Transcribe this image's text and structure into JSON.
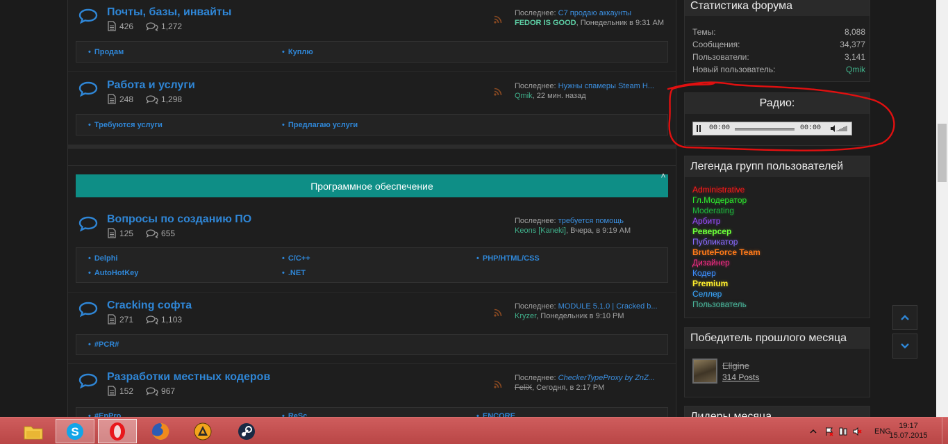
{
  "categories": [
    {
      "nodes": [
        {
          "title": "Почты, базы, инвайты",
          "threads": "426",
          "messages": "1,272",
          "last_prefix": "Последнее:",
          "last_title": "C7 продаю аккаунты",
          "last_user": "FEDOR IS GOOD",
          "last_time": ", Понедельник в 9:31 AM",
          "subforums": [
            "Продам",
            "Куплю"
          ]
        },
        {
          "title": "Работа и услуги",
          "threads": "248",
          "messages": "1,298",
          "last_prefix": "Последнее:",
          "last_title": "Нужны спамеры Steam H...",
          "last_user": "Qmik",
          "last_time": ", 22 мин. назад",
          "subforums": [
            "Требуются услуги",
            "Предлагаю услуги"
          ]
        }
      ]
    },
    {
      "header": "Программное обеспечение",
      "collapse_glyph": "˄",
      "nodes": [
        {
          "title": "Вопросы по созданию ПО",
          "threads": "125",
          "messages": "655",
          "last_prefix": "Последнее:",
          "last_title": "требуется помощь",
          "last_user": "Keons [Kaneki]",
          "last_time": ", Вчера, в 9:19 AM",
          "subforums": [
            "Delphi",
            "C/C++",
            "PHP/HTML/CSS",
            "AutoHotKey",
            ".NET"
          ]
        },
        {
          "title": "Cracking софта",
          "threads": "271",
          "messages": "1,103",
          "last_prefix": "Последнее:",
          "last_title": "MODULE 5.1.0 | Cracked b...",
          "last_user": "Kryzer",
          "last_time": ", Понедельник в 9:10 PM",
          "subforums": [
            "#PCR#"
          ]
        },
        {
          "title": "Разработки местных кодеров",
          "threads": "152",
          "messages": "967",
          "last_prefix": "Последнее:",
          "last_title": "CheckerTypeProxy by ZnZ...",
          "last_user": "FeliX",
          "last_time": ", Сегодня, в 2:17 PM",
          "subforums": [
            "#EnPro",
            "ReSc",
            "ENCORE"
          ]
        }
      ]
    }
  ],
  "sidebar": {
    "stats": {
      "title": "Статистика форума",
      "rows": [
        {
          "label": "Темы:",
          "value": "8,088"
        },
        {
          "label": "Сообщения:",
          "value": "34,377"
        },
        {
          "label": "Пользователи:",
          "value": "3,141"
        },
        {
          "label": "Новый пользователь:",
          "value": "Qmik"
        }
      ]
    },
    "radio": {
      "title": "Радио:",
      "time_elapsed": "00:00",
      "time_total": "00:00"
    },
    "legend": {
      "title": "Легенда групп пользователей",
      "items": [
        {
          "label": "Administrative",
          "color": "#ff1a1a"
        },
        {
          "label": "Гл.Модератор",
          "color": "#2ee82e"
        },
        {
          "label": "Moderating",
          "color": "#1fb53c"
        },
        {
          "label": "Арбитр",
          "color": "#9a4dff"
        },
        {
          "label": "Реверсер",
          "color": "#6cff3a"
        },
        {
          "label": "Публикатор",
          "color": "#8a6bff"
        },
        {
          "label": "BruteForce Team",
          "color": "#ff7a1a"
        },
        {
          "label": "Дизайнер",
          "color": "#ff2d8a"
        },
        {
          "label": "Кодер",
          "color": "#3d8fff"
        },
        {
          "label": "Premium",
          "color": "#ffef2e"
        },
        {
          "label": "Селлер",
          "color": "#3aa8ff"
        },
        {
          "label": "Пользователь",
          "color": "#4ab59a"
        }
      ]
    },
    "winner": {
      "title": "Победитель прошлого месяца",
      "name": "Ellgine",
      "posts": "314 Posts"
    },
    "leaders": {
      "title": "Лидеры месяца"
    }
  },
  "scroll_buttons": {
    "up": "⌃",
    "down": "⌄"
  },
  "taskbar": {
    "apps": [
      "file-explorer",
      "skype",
      "opera",
      "firefox",
      "aimp",
      "steam"
    ],
    "language": "ENG",
    "time": "19:17",
    "date": "15.07.2015"
  }
}
